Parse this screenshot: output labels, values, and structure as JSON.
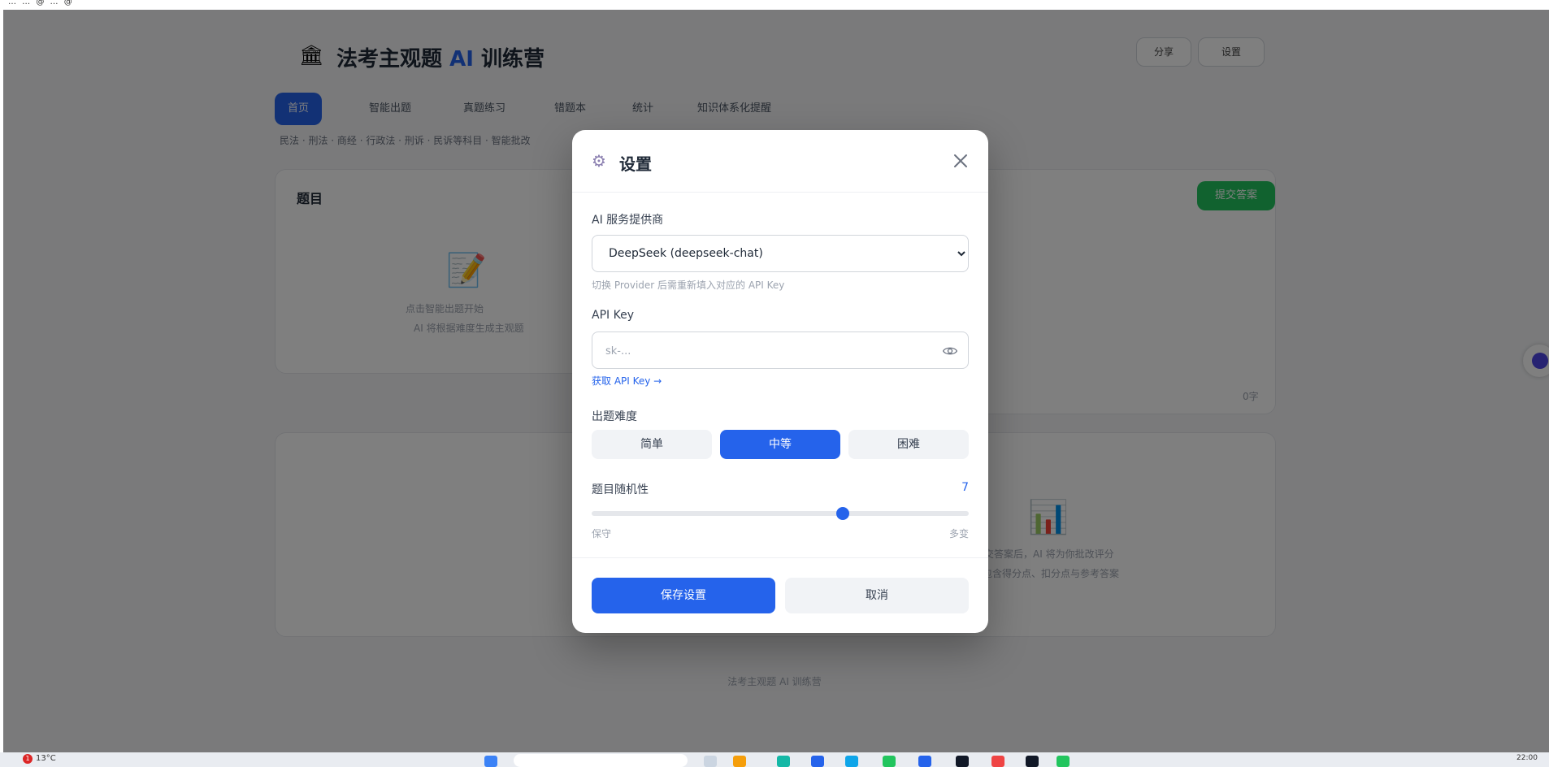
{
  "browser_strip": {
    "text": "… … @ … @"
  },
  "app": {
    "title_prefix": "法考主观题",
    "title_ai": "AI",
    "title_suffix": "训练营",
    "header_btn_1": "分享",
    "header_btn_2": "设置",
    "nav": [
      "首页",
      "智能出题",
      "真题练习",
      "错题本",
      "统计",
      "知识体系化提醒"
    ],
    "subtitle": "民法 · 刑法 · 商经 · 行政法 · 刑诉 · 民诉等科目 · 智能批改",
    "left_card_title": "题目",
    "left_card_hint": "点击智能出题开始",
    "left_card_hint2": "AI 将根据难度生成主观题",
    "right_card_action": "提交答案",
    "right_card_count": "0字",
    "results_hint": "提交答案后，AI 将为你批改评分",
    "results_hint2": "包含得分点、扣分点与参考答案",
    "footer": "法考主观题 AI 训练营"
  },
  "modal": {
    "title": "设置",
    "provider_label": "AI 服务提供商",
    "provider_options": [
      "DeepSeek (deepseek-chat)"
    ],
    "provider_selected": "DeepSeek (deepseek-chat)",
    "provider_hint": "切换 Provider 后需重新填入对应的 API Key",
    "api_key_label": "API Key",
    "api_key_placeholder": "sk-...",
    "api_key_value": "",
    "api_key_link": "获取 API Key →",
    "difficulty_label": "出题难度",
    "difficulty_options": [
      "简单",
      "中等",
      "困难"
    ],
    "difficulty_selected": "中等",
    "randomness_label": "题目随机性",
    "randomness_value": "7",
    "randomness_fraction": 0.667,
    "randomness_min_label": "保守",
    "randomness_max_label": "多变",
    "save_label": "保存设置",
    "cancel_label": "取消"
  },
  "taskbar": {
    "weather": "13°C",
    "weather_badge": "1",
    "time": "22:00"
  },
  "colors": {
    "accent": "#2563eb",
    "success": "#22c55e",
    "overlay": "rgba(0,0,0,0.5)"
  }
}
